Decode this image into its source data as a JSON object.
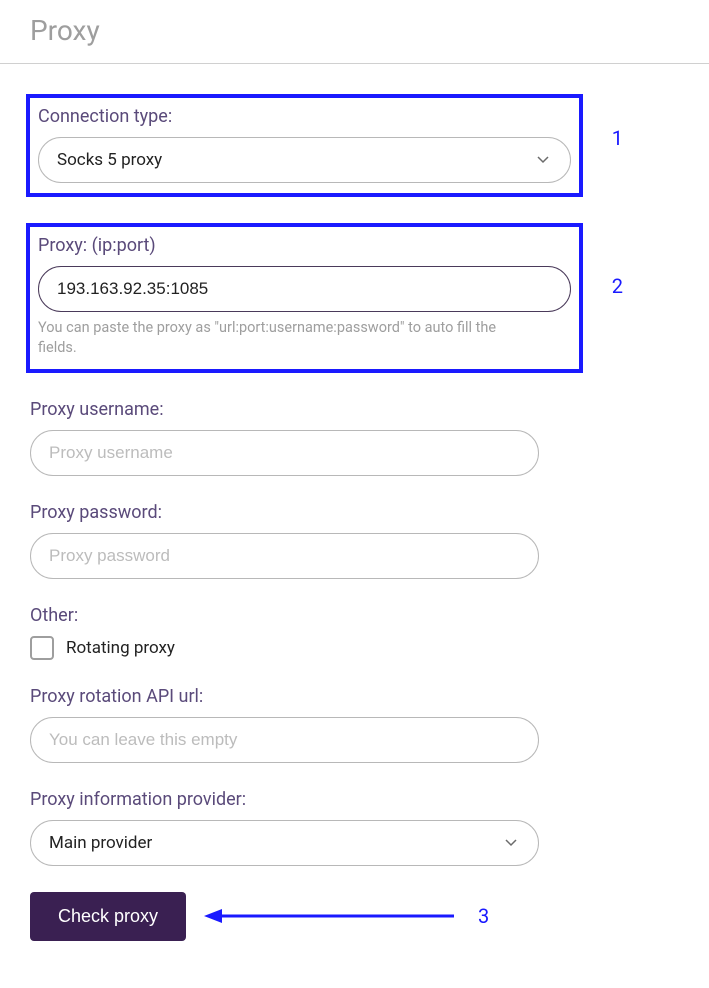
{
  "header": {
    "title": "Proxy"
  },
  "annotations": {
    "one": "1",
    "two": "2",
    "three": "3"
  },
  "connection": {
    "label": "Connection type:",
    "value": "Socks 5 proxy"
  },
  "proxy": {
    "label": "Proxy: (ip:port)",
    "value": "193.163.92.35:1085",
    "hint": "You can paste the proxy as \"url:port:username:password\" to auto fill the fields."
  },
  "username": {
    "label": "Proxy username:",
    "placeholder": "Proxy username",
    "value": ""
  },
  "password": {
    "label": "Proxy password:",
    "placeholder": "Proxy password",
    "value": ""
  },
  "other": {
    "label": "Other:",
    "rotating_label": "Rotating proxy",
    "rotating_checked": false
  },
  "rotation_url": {
    "label": "Proxy rotation API url:",
    "placeholder": "You can leave this empty",
    "value": ""
  },
  "provider": {
    "label": "Proxy information provider:",
    "value": "Main provider"
  },
  "actions": {
    "check_label": "Check proxy"
  }
}
